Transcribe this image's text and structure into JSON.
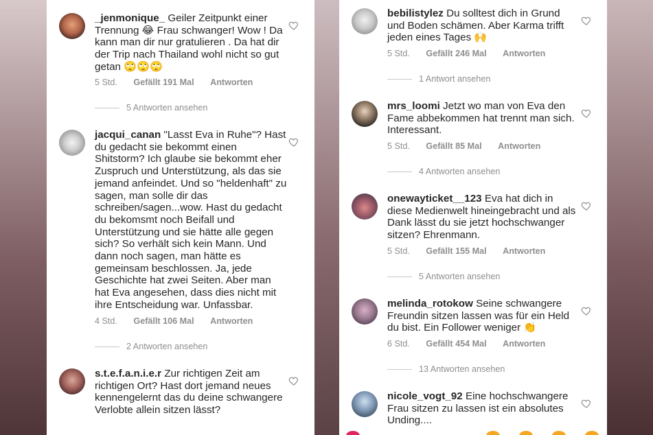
{
  "left": {
    "comments": [
      {
        "username": "_jenmonique_",
        "text": "Geiler Zeitpunkt einer Trennung 😂 Frau schwanger! Wow ! Da kann man dir nur gratulieren . Da hat dir der Trip nach Thailand wohl nicht so gut getan 🙄🙄🙄",
        "time": "5 Std.",
        "likes": "Gefällt 191 Mal",
        "reply": "Antworten",
        "view_replies": "5 Antworten ansehen"
      },
      {
        "username": "jacqui_canan",
        "text": "\"Lasst Eva in Ruhe\"? Hast du gedacht sie bekommt einen Shitstorm? Ich glaube sie bekommt eher Zuspruch und Unterstützung, als das sie jemand anfeindet. Und so \"heldenhaft\" zu sagen, man solle dir das schreiben/sagen...wow. Hast du gedacht du bekomsmt noch Beifall und Unterstützung und sie hätte alle gegen sich? So verhält sich kein Mann. Und dann noch sagen, man hätte es gemeinsam beschlossen. Ja, jede Geschichte hat zwei Seiten. Aber man hat Eva angesehen, dass dies nicht mit ihre Entscheidung war. Unfassbar.",
        "time": "4 Std.",
        "likes": "Gefällt 106 Mal",
        "reply": "Antworten",
        "view_replies": "2 Antworten ansehen"
      },
      {
        "username": "s.t.e.f.a.n.i.e.r",
        "text": "Zur richtigen Zeit am richtigen Ort? Hast dort jemand neues kennengelernt das du deine schwangere Verlobte allein sitzen lässt?"
      }
    ]
  },
  "right": {
    "comments": [
      {
        "username": "bebilistylez",
        "text": "Du solltest dich in Grund und Boden schämen. Aber Karma trifft jeden eines Tages 🙌",
        "time": "5 Std.",
        "likes": "Gefällt 246 Mal",
        "reply": "Antworten",
        "view_replies": "1 Antwort ansehen"
      },
      {
        "username": "mrs_loomi",
        "text": "Jetzt wo man von Eva den Fame abbekommen hat trennt man sich. Interessant.",
        "time": "5 Std.",
        "likes": "Gefällt 85 Mal",
        "reply": "Antworten",
        "view_replies": "4 Antworten ansehen"
      },
      {
        "username": "onewayticket__123",
        "text": "Eva hat dich in diese Medienwelt hineingebracht und als Dank lässt du sie jetzt hochschwanger sitzen? Ehrenmann.",
        "time": "5 Std.",
        "likes": "Gefällt 155 Mal",
        "reply": "Antworten",
        "view_replies": "5 Antworten ansehen"
      },
      {
        "username": "melinda_rotokow",
        "text": "Seine schwangere Freundin sitzen  lassen was für ein Held du bist. Ein Follower weniger 👏",
        "time": "6 Std.",
        "likes": "Gefällt 454 Mal",
        "reply": "Antworten",
        "view_replies": "13 Antworten ansehen"
      },
      {
        "username": "nicole_vogt_92",
        "text": "Eine hochschwangere Frau sitzen zu lassen ist ein absolutes Unding...."
      }
    ]
  },
  "colors": {
    "text": "#262626",
    "muted": "#8e8e8e",
    "background": "#ffffff"
  },
  "icons": {
    "like": "heart-outline-icon"
  }
}
